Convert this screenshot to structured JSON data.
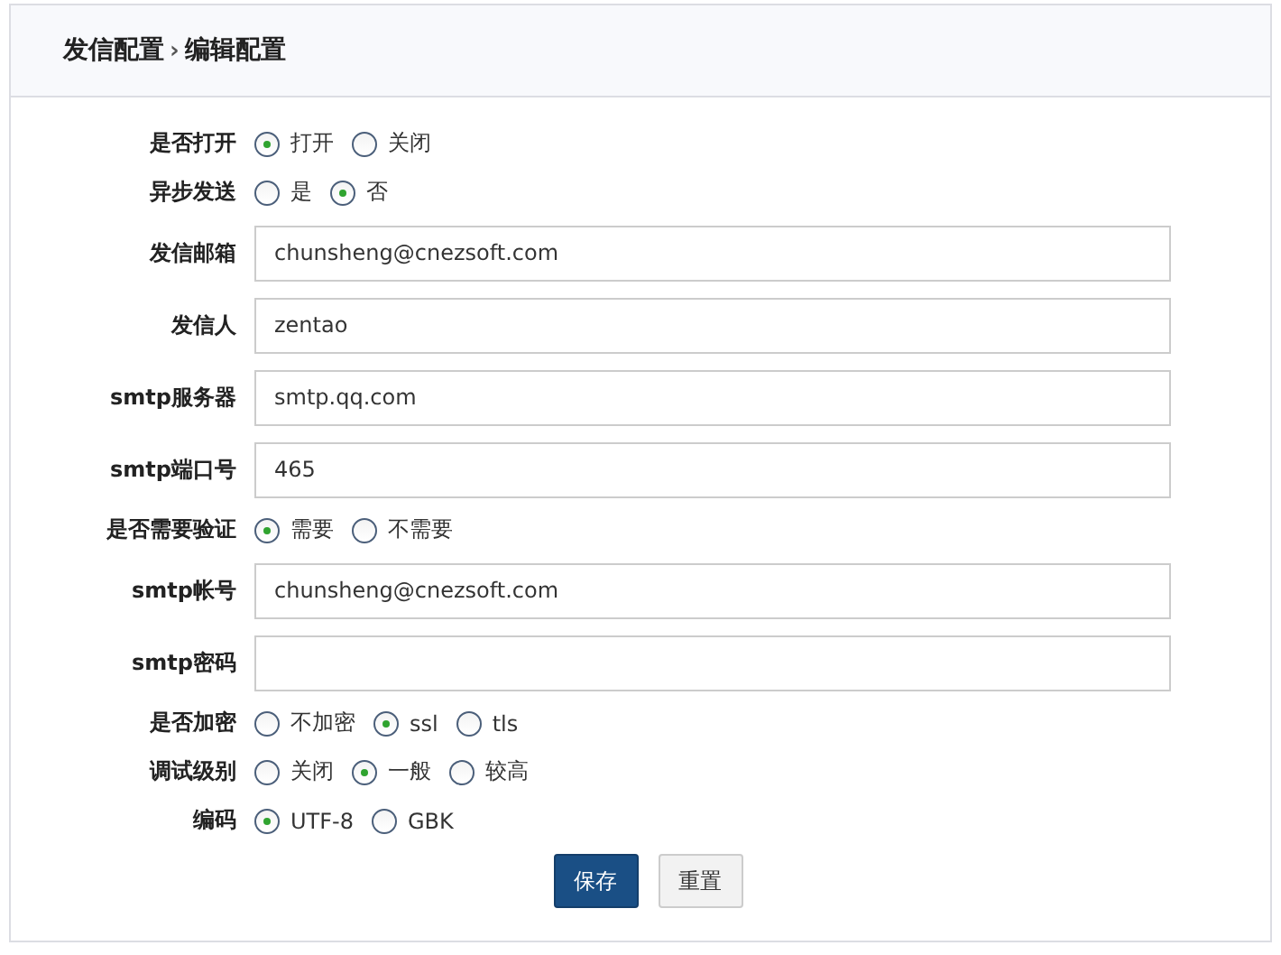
{
  "breadcrumb": {
    "parent": "发信配置",
    "separator": "›",
    "current": "编辑配置"
  },
  "fields": [
    {
      "kind": "radio",
      "label": "是否打开",
      "options": [
        {
          "label": "打开",
          "selected": true
        },
        {
          "label": "关闭",
          "selected": false
        }
      ]
    },
    {
      "kind": "radio",
      "label": "异步发送",
      "options": [
        {
          "label": "是",
          "selected": false
        },
        {
          "label": "否",
          "selected": true
        }
      ]
    },
    {
      "kind": "text",
      "label": "发信邮箱",
      "value": "chunsheng@cnezsoft.com"
    },
    {
      "kind": "text",
      "label": "发信人",
      "value": "zentao"
    },
    {
      "kind": "text",
      "label": "smtp服务器",
      "value": "smtp.qq.com"
    },
    {
      "kind": "text",
      "label": "smtp端口号",
      "value": "465"
    },
    {
      "kind": "radio",
      "label": "是否需要验证",
      "options": [
        {
          "label": "需要",
          "selected": true
        },
        {
          "label": "不需要",
          "selected": false
        }
      ]
    },
    {
      "kind": "text",
      "label": "smtp帐号",
      "value": "chunsheng@cnezsoft.com"
    },
    {
      "kind": "text",
      "label": "smtp密码"
    },
    {
      "kind": "radio",
      "label": "是否加密",
      "options": [
        {
          "label": "不加密",
          "selected": false
        },
        {
          "label": "ssl",
          "selected": true
        },
        {
          "label": "tls",
          "selected": false
        }
      ]
    },
    {
      "kind": "radio",
      "label": "调试级别",
      "options": [
        {
          "label": "关闭",
          "selected": false
        },
        {
          "label": "一般",
          "selected": true
        },
        {
          "label": "较高",
          "selected": false
        }
      ]
    },
    {
      "kind": "radio",
      "label": "编码",
      "options": [
        {
          "label": "UTF-8",
          "selected": true
        },
        {
          "label": "GBK",
          "selected": false
        }
      ]
    }
  ],
  "buttons": [
    {
      "label": "保存",
      "kind": "primary"
    },
    {
      "label": "重置",
      "kind": "default"
    }
  ]
}
